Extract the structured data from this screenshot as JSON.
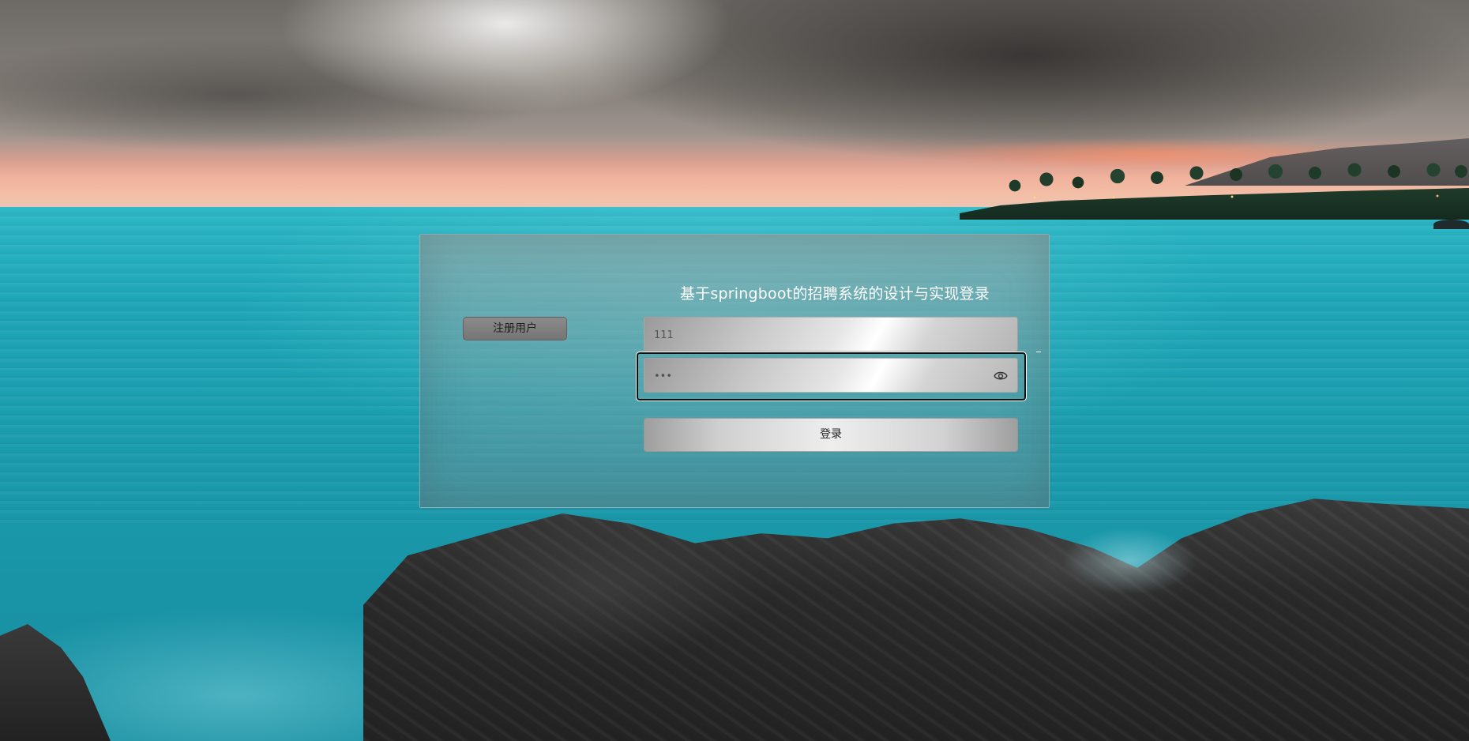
{
  "panel": {
    "title": "基于springboot的招聘系统的设计与实现登录",
    "register_label": "注册用户",
    "username": {
      "value": "111"
    },
    "password": {
      "value": "•••"
    },
    "login_label": "登录"
  },
  "icons": {
    "password_toggle": "eye-icon"
  },
  "colors": {
    "title_text": "#ffffff",
    "focus_border": "#111111"
  }
}
